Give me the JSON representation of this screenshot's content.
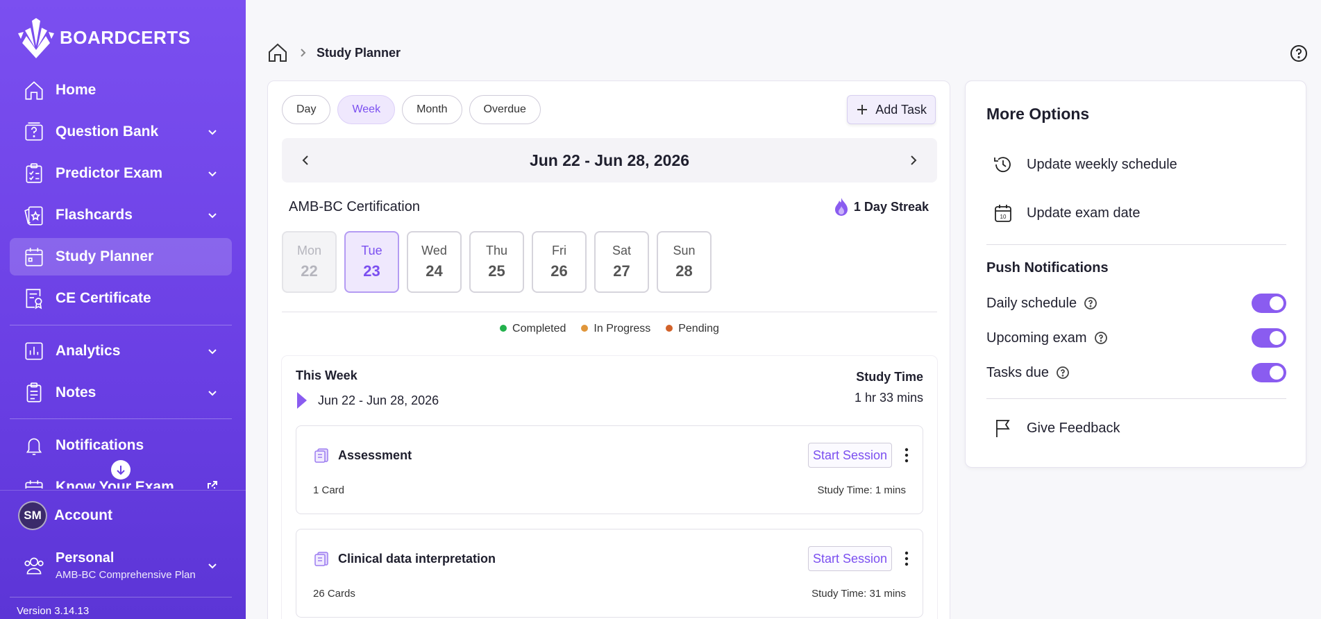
{
  "brand": {
    "name": "BOARDCERTS"
  },
  "sidebar": {
    "items": [
      {
        "label": "Home",
        "icon": "home-icon",
        "expandable": false
      },
      {
        "label": "Question Bank",
        "icon": "question-bank-icon",
        "expandable": true
      },
      {
        "label": "Predictor Exam",
        "icon": "clipboard-icon",
        "expandable": true
      },
      {
        "label": "Flashcards",
        "icon": "flashcards-icon",
        "expandable": true
      },
      {
        "label": "Study Planner",
        "icon": "calendar-icon",
        "expandable": false,
        "active": true
      },
      {
        "label": "CE Certificate",
        "icon": "certificate-icon",
        "expandable": false
      },
      {
        "label": "Analytics",
        "icon": "analytics-icon",
        "expandable": true
      },
      {
        "label": "Notes",
        "icon": "notes-icon",
        "expandable": true
      },
      {
        "label": "Notifications",
        "icon": "bell-icon",
        "expandable": false
      },
      {
        "label": "Know Your Exam",
        "icon": "exam-calendar-icon",
        "external": true
      }
    ],
    "account": {
      "initials": "SM",
      "label": "Account"
    },
    "plan": {
      "name": "Personal",
      "subtitle": "AMB-BC Comprehensive Plan"
    },
    "version": "Version 3.14.13"
  },
  "breadcrumb": {
    "current": "Study Planner"
  },
  "planner": {
    "tabs": [
      {
        "label": "Day",
        "active": false
      },
      {
        "label": "Week",
        "active": true
      },
      {
        "label": "Month",
        "active": false
      },
      {
        "label": "Overdue",
        "active": false
      }
    ],
    "add_task_label": "Add Task",
    "week_range": "Jun 22 - Jun 28, 2026",
    "certification": "AMB-BC Certification",
    "streak": "1 Day Streak",
    "days": [
      {
        "name": "Mon",
        "date": "22",
        "state": "past"
      },
      {
        "name": "Tue",
        "date": "23",
        "state": "today"
      },
      {
        "name": "Wed",
        "date": "24",
        "state": "future"
      },
      {
        "name": "Thu",
        "date": "25",
        "state": "future"
      },
      {
        "name": "Fri",
        "date": "26",
        "state": "future"
      },
      {
        "name": "Sat",
        "date": "27",
        "state": "future"
      },
      {
        "name": "Sun",
        "date": "28",
        "state": "future"
      }
    ],
    "legend": [
      {
        "label": "Completed",
        "color": "#22b14c"
      },
      {
        "label": "In Progress",
        "color": "#e0963a"
      },
      {
        "label": "Pending",
        "color": "#d2622a"
      }
    ],
    "this_week": {
      "title": "This Week",
      "range": "Jun 22 - Jun 28, 2026",
      "study_time_label": "Study Time",
      "study_time_value": "1 hr 33 mins"
    },
    "tasks": [
      {
        "name": "Assessment",
        "count": "1 Card",
        "button": "Start Session",
        "study_time": "Study Time: 1 mins"
      },
      {
        "name": "Clinical data interpretation",
        "count": "26 Cards",
        "button": "Start Session",
        "study_time": "Study Time: 31 mins"
      }
    ]
  },
  "more_options": {
    "title": "More Options",
    "options": [
      {
        "label": "Update weekly schedule",
        "icon": "history-icon"
      },
      {
        "label": "Update exam date",
        "icon": "calendar-date-icon"
      }
    ],
    "push_title": "Push Notifications",
    "toggles": [
      {
        "label": "Daily schedule",
        "on": true
      },
      {
        "label": "Upcoming exam",
        "on": true
      },
      {
        "label": "Tasks due",
        "on": true
      }
    ],
    "feedback_label": "Give Feedback"
  },
  "colors": {
    "accent": "#7b4ff0",
    "sidebar_top": "#7b4ff0",
    "sidebar_bottom": "#5c35d6"
  }
}
